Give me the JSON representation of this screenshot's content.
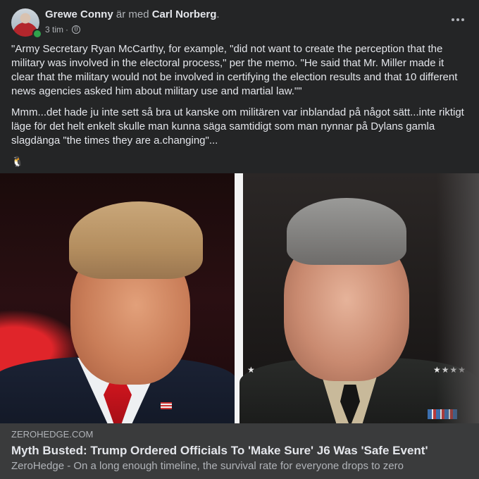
{
  "post": {
    "author_name": "Grewe Conny",
    "with_text": "är med",
    "tagged_name": "Carl Norberg",
    "period": ".",
    "timestamp": "3 tim",
    "separator": "·",
    "privacy_icon": "globe-icon",
    "more_icon": "more-options-icon",
    "paragraphs": [
      "\"Army Secretary Ryan McCarthy, for example, \"did not want to create the perception that the military was involved in the electoral process,\" per the memo. \"He said that Mr. Miller made it clear that the military would not be involved in certifying the election results and that 10 different news agencies asked him about military use and martial law.\"\"",
      "Mmm...det hade ju inte sett så bra ut kanske om militären var inblandad på något sätt...inte riktigt läge för det helt enkelt skulle man kunna säga samtidigt som man nynnar på Dylans gamla slagdänga \"the times they are a.changing\"..."
    ],
    "emoji": "🐧"
  },
  "link_preview": {
    "domain": "ZEROHEDGE.COM",
    "title": "Myth Busted: Trump Ordered Officials To 'Make Sure' J6 Was 'Safe Event'",
    "description": "ZeroHedge - On a long enough timeline, the survival rate for everyone drops to zero"
  },
  "colors": {
    "background": "#242526",
    "text_primary": "#e4e6eb",
    "text_secondary": "#b0b3b8",
    "online": "#31a24c",
    "link_footer": "#3a3b3c"
  }
}
